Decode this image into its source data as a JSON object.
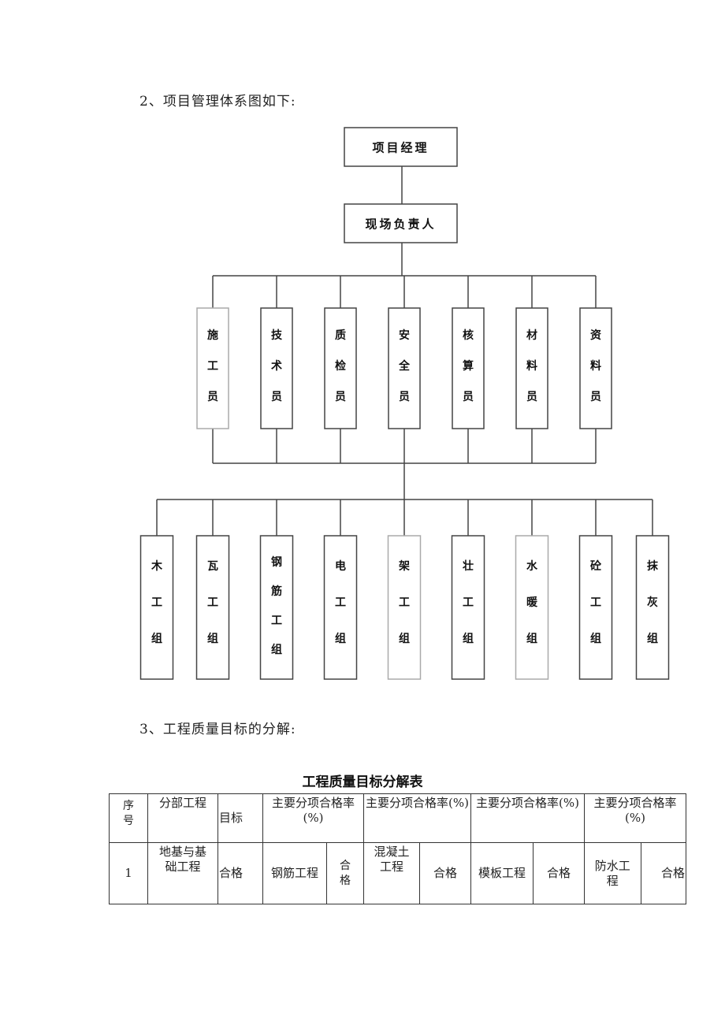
{
  "section2": {
    "heading": "2、项目管理体系图如下:"
  },
  "org_chart": {
    "root": "项目经理",
    "second": "现场负责人",
    "staff": [
      "施工员",
      "技术员",
      "质检员",
      "安全员",
      "核算员",
      "材料员",
      "资料员"
    ],
    "teams": [
      "木工组",
      "瓦工组",
      "钢筋工组",
      "电工组",
      "架工组",
      "壮工组",
      "水暖组",
      "砼工组",
      "抹灰组"
    ]
  },
  "section3": {
    "heading": "3、工程质量目标的分解:"
  },
  "table": {
    "title": "工程质量目标分解表",
    "headers": {
      "seq": "序号",
      "division": "分部工程",
      "target": "目标",
      "rate1": "主要分项合格率(%)",
      "rate2": "主要分项合格率(%)",
      "rate3": "主要分项合格率(%)",
      "rate4": "主要分项合格率(%)"
    },
    "rows": [
      {
        "seq": "1",
        "division": "地基与基础工程",
        "target": "合格",
        "item1": "钢筋工程",
        "result1": "合格",
        "item2": "混凝土工程",
        "result2": "合格",
        "item3": "模板工程",
        "result3": "合格",
        "item4": "防水工程",
        "result4": "合格"
      }
    ]
  }
}
